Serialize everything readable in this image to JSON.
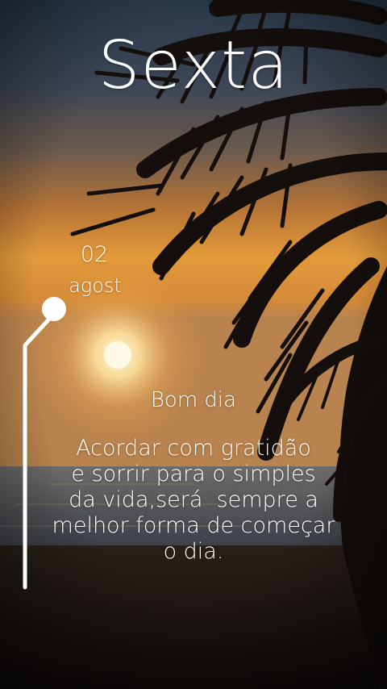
{
  "title": "Sexta",
  "date": {
    "day": "02",
    "month": "agost"
  },
  "greeting": "Bom dia",
  "message_lines": [
    "Acordar com gratidão",
    "e sorrir para o simples",
    "da vida,será  sempre a",
    "melhor forma de começar",
    "o dia."
  ],
  "colors": {
    "text": "#ffffff",
    "sky_top": "#2a3a4c",
    "sunset_glow": "#e39a3a",
    "sea": "#5a6470",
    "sand": "#1d1612"
  },
  "icons": {
    "background": "palm-tree-sunset-photo",
    "decoration": "lamp-post-icon"
  }
}
